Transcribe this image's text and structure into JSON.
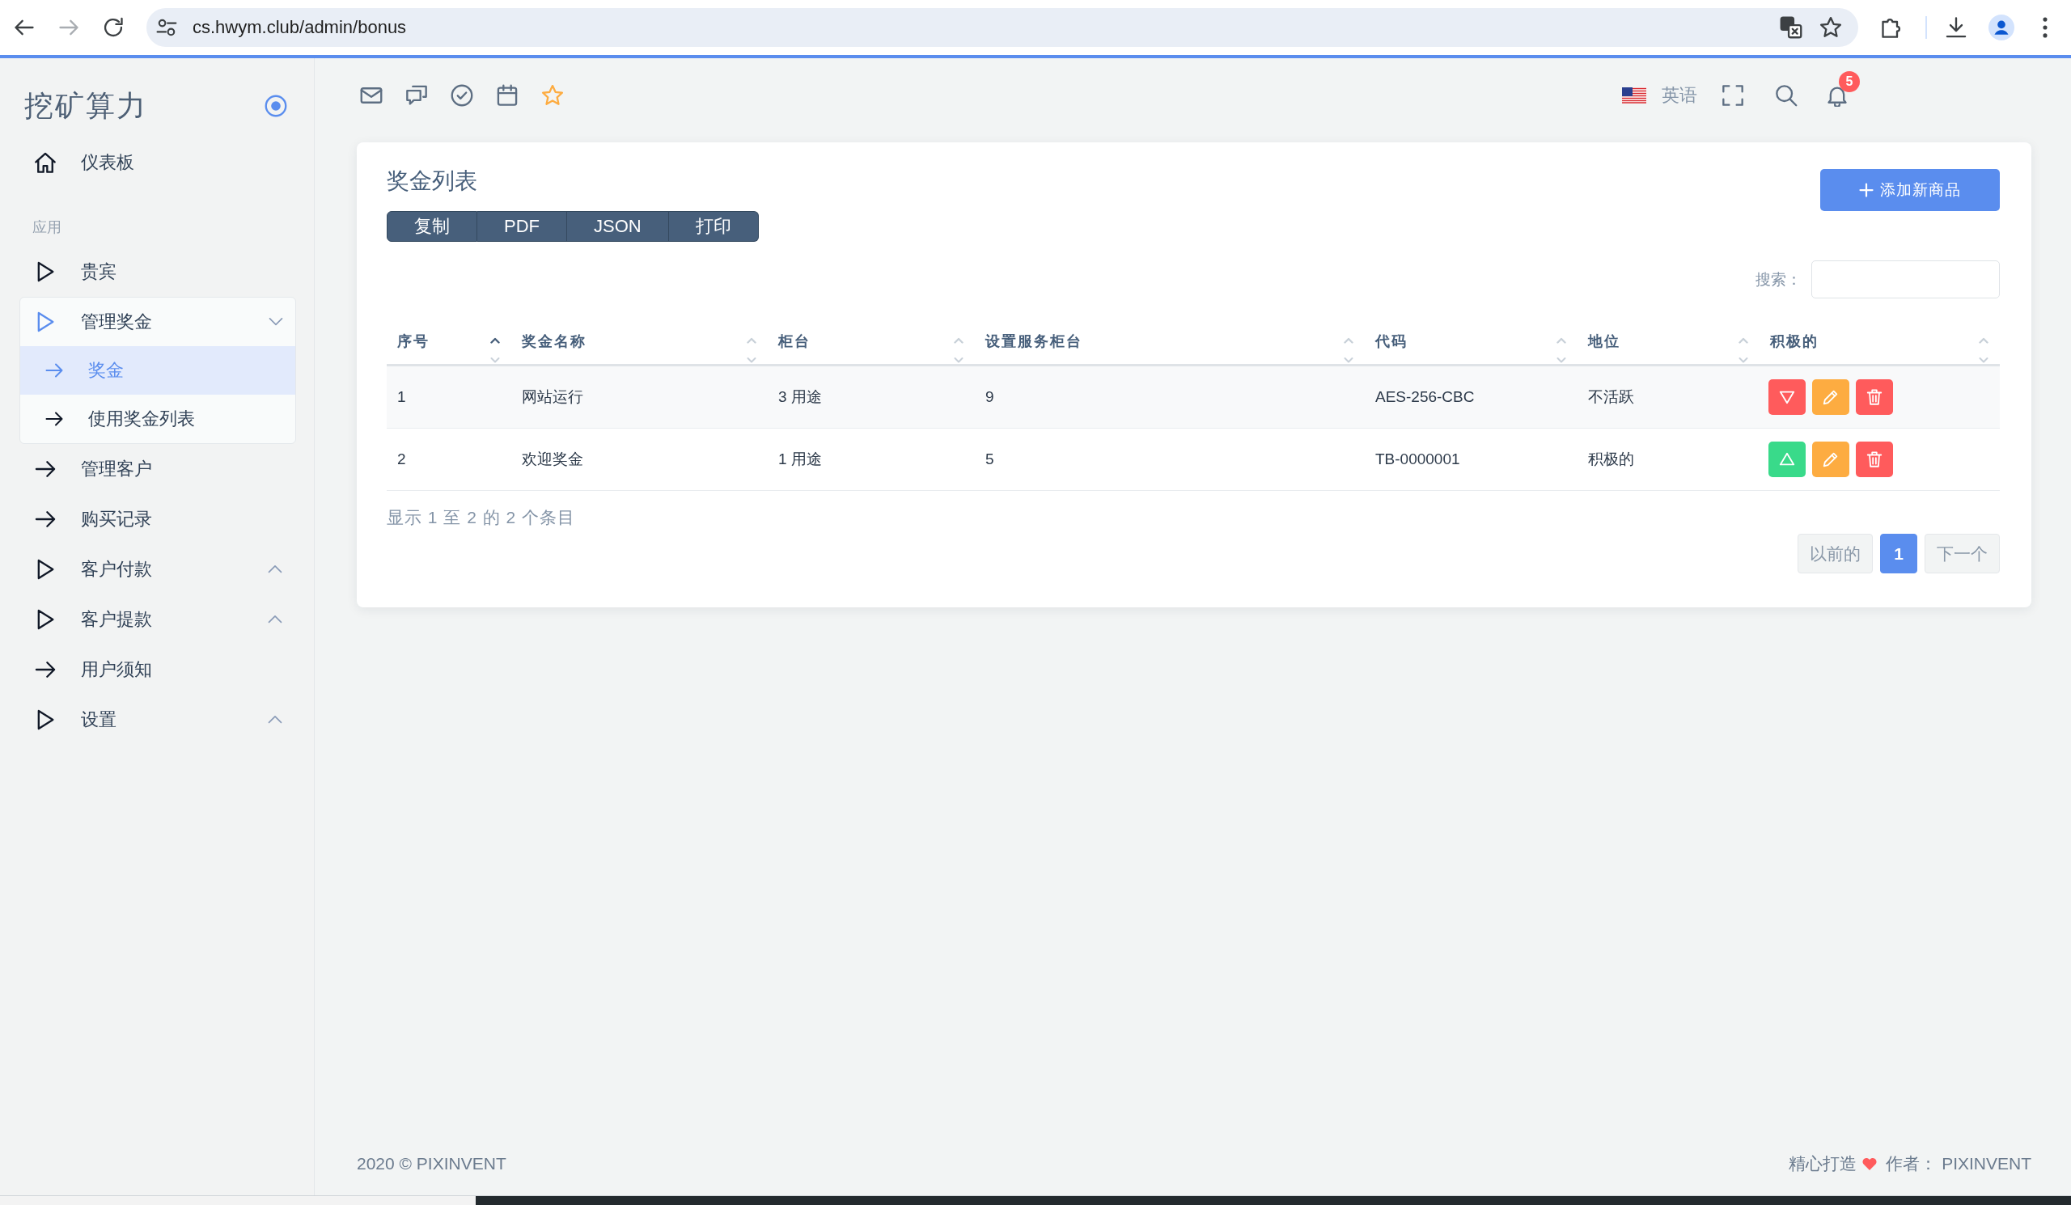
{
  "browser": {
    "back": {
      "disabled": false
    },
    "forward": {
      "disabled": true
    },
    "url": "cs.hwym.club/admin/bonus"
  },
  "sidebar": {
    "brand": "挖矿算力",
    "sections": [
      {
        "items": [
          {
            "kind": "home",
            "label": "仪表板",
            "selected": false
          }
        ]
      },
      {
        "title": "应用",
        "items": [
          {
            "kind": "module",
            "label": "贵宾",
            "selected": false
          },
          {
            "kind": "group",
            "label": "管理奖金",
            "selected": false,
            "expanded": true,
            "children": [
              {
                "label": "奖金",
                "selected": true
              },
              {
                "label": "使用奖金列表",
                "selected": false
              }
            ]
          },
          {
            "kind": "link",
            "label": "管理客户",
            "selected": false
          },
          {
            "kind": "link",
            "label": "购买记录",
            "selected": false
          },
          {
            "kind": "group",
            "label": "客户付款",
            "selected": false,
            "expanded": false
          },
          {
            "kind": "group",
            "label": "客户提款",
            "selected": false,
            "expanded": false
          },
          {
            "kind": "link",
            "label": "用户须知",
            "selected": false
          },
          {
            "kind": "group",
            "label": "设置",
            "selected": false,
            "expanded": false
          }
        ]
      }
    ]
  },
  "navbar": {
    "language": "英语",
    "notification_count": "5"
  },
  "card": {
    "title": "奖金列表",
    "export_buttons": [
      "复制",
      "PDF",
      "JSON",
      "打印"
    ],
    "add_button": "添加新商品",
    "search": {
      "label": "搜索："
    },
    "table": {
      "columns": [
        {
          "label": "序号",
          "sorted": true
        },
        {
          "label": "奖金名称",
          "sorted": false
        },
        {
          "label": "柜台",
          "sorted": false
        },
        {
          "label": "设置服务柜台",
          "sorted": false
        },
        {
          "label": "代码",
          "sorted": false
        },
        {
          "label": "地位",
          "sorted": false
        },
        {
          "label": "积极的",
          "sorted": false
        }
      ],
      "rows": [
        {
          "cells": [
            "1",
            "网站运行",
            "3 用途",
            "9",
            "AES-256-CBC",
            "不活跃"
          ],
          "active": false
        },
        {
          "cells": [
            "2",
            "欢迎奖金",
            "1 用途",
            "5",
            "TB-0000001",
            "积极的"
          ],
          "active": true
        }
      ]
    },
    "info": "显示 1 至 2 的 2 个条目",
    "pagination": {
      "previous": {
        "label": "以前的",
        "disabled": true
      },
      "pages": [
        {
          "label": "1",
          "selected": true
        }
      ],
      "next": {
        "label": "下一个",
        "disabled": true
      }
    }
  },
  "footer": {
    "copyright": "2020 © PIXINVENT",
    "credit_before": "精心打造",
    "credit_after": "作者： PIXINVENT"
  }
}
